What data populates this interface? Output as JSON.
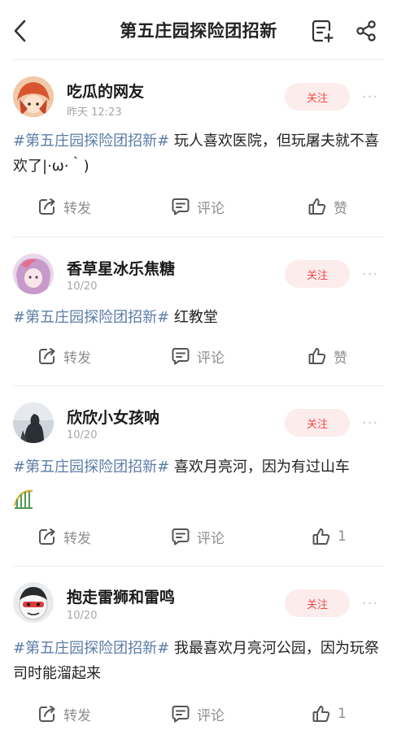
{
  "header": {
    "title": "第五庄园探险团招新",
    "back_icon": "chevron-left-icon",
    "note_icon": "add-note-icon",
    "share_icon": "share-icon"
  },
  "posts": [
    {
      "username": "吃瓜的网友",
      "time": "昨天 12:23",
      "follow_label": "关注",
      "more": "···",
      "topic": "#第五庄园探险团招新#",
      "text": " 玩人喜欢医院，但玩屠夫就不喜欢了|·ω·｀)",
      "repost_label": "转发",
      "comment_label": "评论",
      "like_label": "赞"
    },
    {
      "username": "香草星冰乐焦糖",
      "time": "10/20",
      "follow_label": "关注",
      "more": "···",
      "topic": "#第五庄园探险团招新#",
      "text": " 红教堂",
      "repost_label": "转发",
      "comment_label": "评论",
      "like_label": "赞"
    },
    {
      "username": "欣欣小女孩呐",
      "time": "10/20",
      "follow_label": "关注",
      "more": "···",
      "topic": "#第五庄园探险团招新#",
      "text": " 喜欢月亮河，因为有过山车",
      "repost_label": "转发",
      "comment_label": "评论",
      "like_label": "1"
    },
    {
      "username": "抱走雷狮和雷鸣",
      "time": "10/20",
      "follow_label": "关注",
      "more": "···",
      "topic": "#第五庄园探险团招新#",
      "text": " 我最喜欢月亮河公园，因为玩祭司时能溜起来",
      "repost_label": "转发",
      "comment_label": "评论",
      "like_label": "1"
    }
  ],
  "colors": {
    "accent_red": "#ef4a4a",
    "follow_bg": "#fdecec",
    "topic_blue": "#5b7ca6",
    "muted": "#8e8e8e"
  }
}
